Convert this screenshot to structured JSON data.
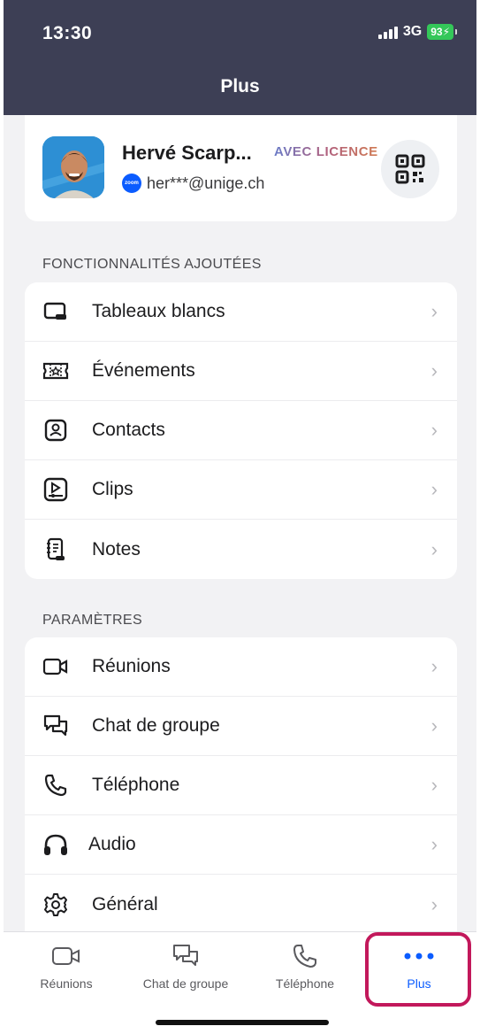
{
  "status_bar": {
    "time": "13:30",
    "network": "3G",
    "battery": "93"
  },
  "header": {
    "title": "Plus"
  },
  "profile": {
    "name": "Hervé Scarp...",
    "license": "AVEC LICENCE",
    "email": "her***@unige.ch",
    "zoom_badge": "zoom"
  },
  "sections": {
    "features_label": "FONCTIONNALITÉS AJOUTÉES",
    "features": [
      {
        "label": "Tableaux blancs",
        "icon": "whiteboard-icon"
      },
      {
        "label": "Événements",
        "icon": "ticket-icon"
      },
      {
        "label": "Contacts",
        "icon": "contact-icon"
      },
      {
        "label": "Clips",
        "icon": "clips-icon"
      },
      {
        "label": "Notes",
        "icon": "notes-icon"
      }
    ],
    "settings_label": "PARAMÈTRES",
    "settings": [
      {
        "label": "Réunions",
        "icon": "video-icon"
      },
      {
        "label": "Chat de groupe",
        "icon": "chat-icon"
      },
      {
        "label": "Téléphone",
        "icon": "phone-icon"
      },
      {
        "label": "Audio",
        "icon": "headphones-icon"
      },
      {
        "label": "Général",
        "icon": "gear-icon"
      }
    ]
  },
  "tabbar": {
    "tabs": [
      {
        "label": "Réunions",
        "icon": "video-icon"
      },
      {
        "label": "Chat de groupe",
        "icon": "chat-icon"
      },
      {
        "label": "Téléphone",
        "icon": "phone-icon"
      },
      {
        "label": "Plus",
        "icon": "more-icon",
        "active": true
      }
    ]
  },
  "colors": {
    "header_bg": "#3d3f55",
    "accent": "#0b5cff",
    "highlight": "#c2185b"
  }
}
